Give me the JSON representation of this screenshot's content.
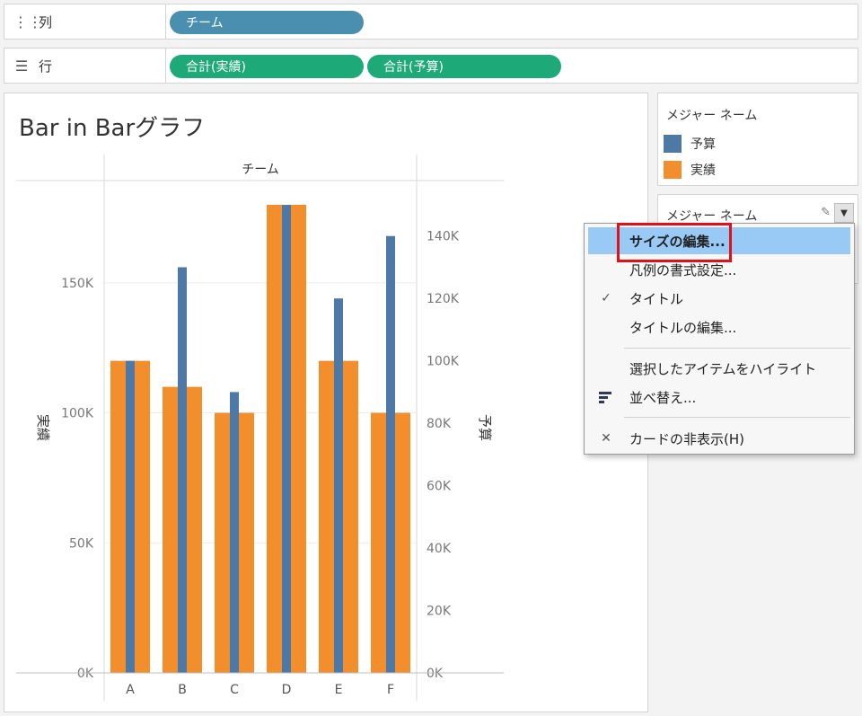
{
  "shelves": {
    "columns": {
      "icon": "columns-icon",
      "label": "列",
      "pills": [
        "チーム"
      ]
    },
    "rows": {
      "icon": "rows-icon",
      "label": "行",
      "pills": [
        "合計(実績)",
        "合計(予算)"
      ]
    }
  },
  "view": {
    "title": "Bar in Barグラフ"
  },
  "legend": {
    "title": "メジャー ネーム",
    "items": [
      {
        "label": "予算",
        "color": "#4e79a7"
      },
      {
        "label": "実績",
        "color": "#f28e2b"
      }
    ]
  },
  "size_card": {
    "title": "メジャー ネーム",
    "edit_icon": "pencil-icon",
    "dropdown_icon": "caret-down-icon"
  },
  "context_menu": {
    "items": [
      {
        "label": "サイズの編集...",
        "highlighted": true,
        "icon": ""
      },
      {
        "label": "凡例の書式設定...",
        "icon": ""
      },
      {
        "label": "タイトル",
        "icon": "checkmark-icon"
      },
      {
        "label": "タイトルの編集...",
        "icon": ""
      },
      {
        "label": "選択したアイテムをハイライト",
        "icon": ""
      },
      {
        "label": "並べ替え...",
        "icon": "sort-icon"
      },
      {
        "label": "カードの非表示(H)",
        "icon": "close-icon"
      }
    ]
  },
  "chart_data": {
    "type": "bar",
    "header": "チーム",
    "categories": [
      "A",
      "B",
      "C",
      "D",
      "E",
      "F"
    ],
    "series": [
      {
        "name": "実績",
        "axis": "left",
        "color": "#f28e2b",
        "values": [
          120000,
          110000,
          100000,
          180000,
          120000,
          100000
        ]
      },
      {
        "name": "予算",
        "axis": "right",
        "color": "#4e79a7",
        "values": [
          100000,
          130000,
          90000,
          150000,
          120000,
          140000
        ]
      }
    ],
    "y_left": {
      "label": "実績",
      "range": [
        0,
        180000
      ],
      "ticks": [
        "0K",
        "50K",
        "100K",
        "150K"
      ],
      "tick_values": [
        0,
        50000,
        100000,
        150000
      ]
    },
    "y_right": {
      "label": "予算",
      "range": [
        0,
        150000
      ],
      "ticks": [
        "0K",
        "20K",
        "40K",
        "60K",
        "80K",
        "100K",
        "120K",
        "140K"
      ],
      "tick_values": [
        0,
        20000,
        40000,
        60000,
        80000,
        100000,
        120000,
        140000
      ]
    },
    "grid": true
  }
}
